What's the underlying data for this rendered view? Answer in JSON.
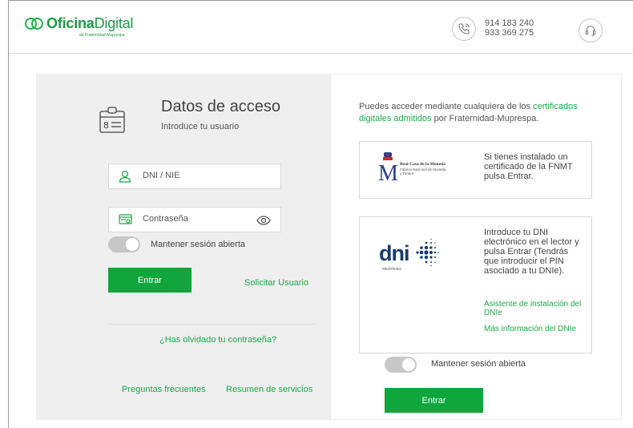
{
  "header": {
    "logo": {
      "brand_bold": "Oficina",
      "brand_second": "Digital",
      "tagline": "de Fraternidad-Muprespa"
    },
    "phone_icon": "phone-icon",
    "phones": [
      "914 183 240",
      "933 369 275"
    ],
    "support_icon": "headset-icon"
  },
  "login": {
    "title": "Datos de acceso",
    "subtitle": "Introduce tu usuario",
    "dni_placeholder": "DNI / NIE",
    "password_placeholder": "Contraseña",
    "keep_session_label": "Mantener sesión abierta",
    "submit_label": "Entrar",
    "request_user_link": "Solicitar Usuario",
    "forgot_password_link": "¿Has olvidado tu contraseña?",
    "faq_link": "Preguntas frecuentes",
    "services_link": "Resumen de servicios"
  },
  "certificates": {
    "intro_prefix": "Puedes acceder mediante cualquiera de los ",
    "intro_link": "certificados digitales admitidos",
    "intro_suffix": " por Fraternidad-Muprespa.",
    "fnmt": {
      "org_name": "Real Casa de la Moneda",
      "org_sub": "Fábrica Nacional de Moneda y Timbre",
      "text": "Si tienes instalado un certificado de la FNMT pulsa Entrar."
    },
    "dnie": {
      "logo_word": "dni",
      "logo_sub": "electrónico",
      "text": "Introduce tu DNI electrónico en el lector y pulsa Entrar (Tendrás que introducir el PIN asociado a tu DNIe).",
      "install_link": "Asistente de instalación del DNIe",
      "info_link": "Más información del DNIe"
    },
    "keep_session_label": "Mantener sesión abierta",
    "submit_label": "Entrar"
  },
  "colors": {
    "accent": "#11a63d",
    "link": "#1fa84a",
    "panel_bg": "#efefef",
    "dni_blue": "#173c6e"
  }
}
